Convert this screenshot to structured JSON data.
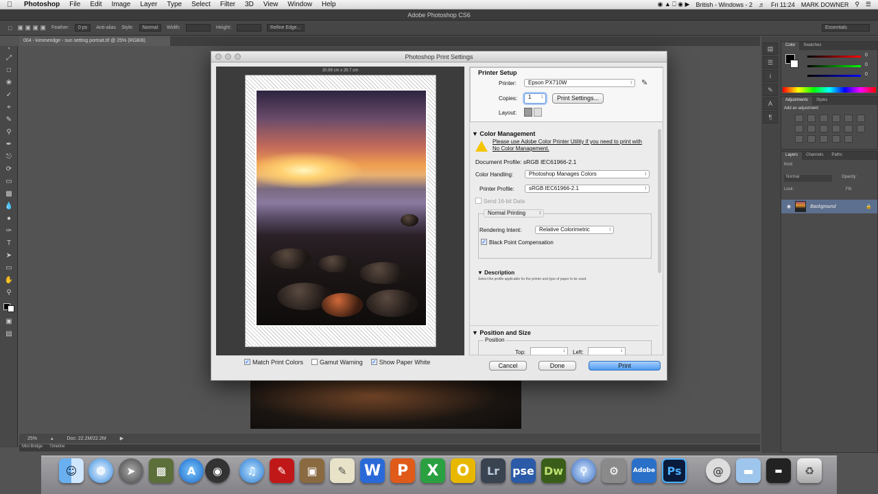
{
  "menubar": {
    "app_name": "Photoshop",
    "items": [
      "File",
      "Edit",
      "Image",
      "Layer",
      "Type",
      "Select",
      "Filter",
      "3D",
      "View",
      "Window",
      "Help"
    ],
    "clock": "Fri 11:24",
    "user": "MARK DOWNER",
    "input_source": "British - Windows - 2"
  },
  "appbar": {
    "title": "Adobe Photoshop CS6"
  },
  "options": {
    "feather_label": "Feather:",
    "feather_value": "0 px",
    "antialias_label": "Anti-alias",
    "style_label": "Style:",
    "style_value": "Normal",
    "width_label": "Width:",
    "height_label": "Height:",
    "refine_label": "Refine Edge...",
    "workspace": "Essentials"
  },
  "document": {
    "tab_title": "004 - kimmeridge - sun setting portrait.tif @ 25% (RGB/8)"
  },
  "status": {
    "zoom": "25%",
    "doc_size": "Doc: 22.2M/22.2M"
  },
  "minibridge": {
    "tabs": [
      "Mini Bridge",
      "Timeline"
    ]
  },
  "panels": {
    "color_tabs": [
      "Color",
      "Swatches"
    ],
    "color_values": [
      "0",
      "0",
      "0"
    ],
    "adjust_tabs": [
      "Adjustments",
      "Styles"
    ],
    "adjust_hint": "Add an adjustment",
    "layer_tabs": [
      "Layers",
      "Channels",
      "Paths"
    ],
    "blend_mode": "Normal",
    "opacity_label": "Opacity:",
    "lock_label": "Lock:",
    "fill_label": "Fill:",
    "kind_label": "Kind",
    "layer_name": "Background"
  },
  "dialog": {
    "title": "Photoshop Print Settings",
    "paper_size": "20.99 cm x 29.7 cm",
    "match_print_colors": "Match Print Colors",
    "gamut_warning": "Gamut Warning",
    "show_paper_white": "Show Paper White",
    "cancel": "Cancel",
    "done": "Done",
    "print": "Print",
    "printer_setup": {
      "header": "Printer Setup",
      "printer_label": "Printer:",
      "printer_value": "Epson PX710W",
      "copies_label": "Copies:",
      "copies_value": "1",
      "print_settings_button": "Print Settings...",
      "layout_label": "Layout:"
    },
    "color_management": {
      "header": "Color Management",
      "warning": "Please use Adobe Color Printer Utility if you need to print with No Color Management.",
      "document_profile": "Document Profile: sRGB IEC61966-2.1",
      "color_handling_label": "Color Handling:",
      "color_handling_value": "Photoshop Manages Colors",
      "printer_profile_label": "Printer Profile:",
      "printer_profile_value": "sRGB IEC61966-2.1",
      "send_16bit": "Send 16-bit Data",
      "normal_printing": "Normal Printing",
      "rendering_intent_label": "Rendering Intent:",
      "rendering_intent_value": "Relative Colorimetric",
      "black_point": "Black Point Compensation",
      "description_header": "Description",
      "description_text": "Select the profile applicable for the printer and type of paper to be used."
    },
    "position_size": {
      "header": "Position and Size",
      "position_label": "Position",
      "top_label": "Top:",
      "left_label": "Left:"
    }
  },
  "dock": {
    "icons": [
      "finder-icon",
      "safari-icon",
      "launchpad-icon",
      "photo-booth-icon",
      "app-store-icon",
      "facetime-icon",
      "itunes-icon",
      "photo-app-icon",
      "preview-icon",
      "textedit-icon",
      "word-icon",
      "powerpoint-icon",
      "excel-icon",
      "outlook-icon",
      "lightroom-icon",
      "photoshop-elements-icon",
      "dreamweaver-icon",
      "network-utility-icon",
      "system-preferences-icon",
      "adobe-app-icon",
      "photoshop-icon",
      "mail-icon",
      "folder-icon",
      "downloads-icon",
      "trash-icon"
    ],
    "labels": {
      "lr": "Lr",
      "pse": "pse",
      "dw": "Dw",
      "ps": "Ps",
      "word": "W",
      "excel": "X",
      "outlook": "O",
      "adobe": "Adobe"
    }
  }
}
